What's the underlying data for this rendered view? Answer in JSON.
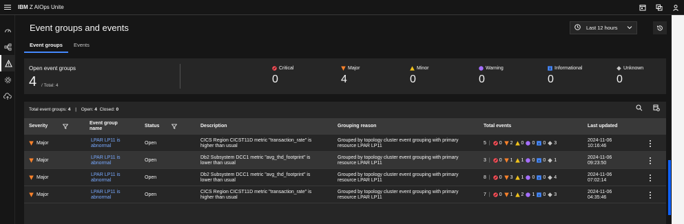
{
  "app": {
    "brand_bold": "IBM",
    "brand_rest": " Z AIOps Unite"
  },
  "page": {
    "title": "Event groups and events",
    "time_range": "Last 12 hours"
  },
  "tabs": [
    {
      "label": "Event groups"
    },
    {
      "label": "Events"
    }
  ],
  "summary": {
    "title": "Open event groups",
    "count": "4",
    "total": "/ Total: 4",
    "severities": [
      {
        "label": "Critical",
        "value": "0",
        "color": "#fa4d56"
      },
      {
        "label": "Major",
        "value": "4",
        "color": "#ff832b"
      },
      {
        "label": "Minor",
        "value": "0",
        "color": "#f1c21b"
      },
      {
        "label": "Warning",
        "value": "0",
        "color": "#a56eff"
      },
      {
        "label": "Informational",
        "value": "0",
        "color": "#4589ff"
      },
      {
        "label": "Unknown",
        "value": "0",
        "color": "#c6c6c6"
      }
    ]
  },
  "table": {
    "toolbar": {
      "total_label": "Total event groups:",
      "total_value": "4",
      "open_label": "Open:",
      "open_value": "4",
      "closed_label": "Closed:",
      "closed_value": "0"
    },
    "headers": {
      "severity": "Severity",
      "name_1": "Event group",
      "name_2": "name",
      "status": "Status",
      "description": "Description",
      "grouping": "Grouping reason",
      "total": "Total events",
      "updated": "Last updated"
    },
    "rows": [
      {
        "severity": "Major",
        "name_1": "LPAR LP11 is",
        "name_2": "abnormal",
        "status": "Open",
        "desc_1": "CICS Region CICST11D metric \"transaction_rate\" is",
        "desc_2": "higher than usual",
        "group_1": "Grouped by topology cluster event grouping with primary",
        "group_2": "resource LPAR LP11",
        "total": "5",
        "c_crit": "0",
        "c_major": "2",
        "c_minor": "0",
        "c_warn": "0",
        "c_info": "0",
        "c_unk": "3",
        "date": "2024-11-06",
        "time": "10:16:46"
      },
      {
        "severity": "Major",
        "name_1": "LPAR LP11 is",
        "name_2": "abnormal",
        "status": "Open",
        "desc_1": "Db2 Subsystem DCC1 metric \"avg_thd_footprint\" is",
        "desc_2": "lower than usual",
        "group_1": "Grouped by topology cluster event grouping with primary",
        "group_2": "resource LPAR LP11",
        "total": "3",
        "c_crit": "0",
        "c_major": "1",
        "c_minor": "1",
        "c_warn": "0",
        "c_info": "0",
        "c_unk": "1",
        "date": "2024-11-06",
        "time": "09:23:50"
      },
      {
        "severity": "Major",
        "name_1": "LPAR LP11 is",
        "name_2": "abnormal",
        "status": "Open",
        "desc_1": "Db2 Subsystem DCC1 metric \"avg_thd_footprint\" is",
        "desc_2": "lower than usual",
        "group_1": "Grouped by topology cluster event grouping with primary",
        "group_2": "resource LPAR LP11",
        "total": "8",
        "c_crit": "0",
        "c_major": "3",
        "c_minor": "1",
        "c_warn": "0",
        "c_info": "0",
        "c_unk": "4",
        "date": "2024-11-06",
        "time": "07:02:14"
      },
      {
        "severity": "Major",
        "name_1": "LPAR LP11 is",
        "name_2": "abnormal",
        "status": "Open",
        "desc_1": "CICS Region CICST11D metric \"transaction_rate\" is",
        "desc_2": "higher than usual",
        "group_1": "Grouped by topology cluster event grouping with primary",
        "group_2": "resource LPAR LP11",
        "total": "7",
        "c_crit": "0",
        "c_major": "1",
        "c_minor": "2",
        "c_warn": "1",
        "c_info": "0",
        "c_unk": "3",
        "date": "2024-11-06",
        "time": "04:35:46"
      }
    ]
  }
}
